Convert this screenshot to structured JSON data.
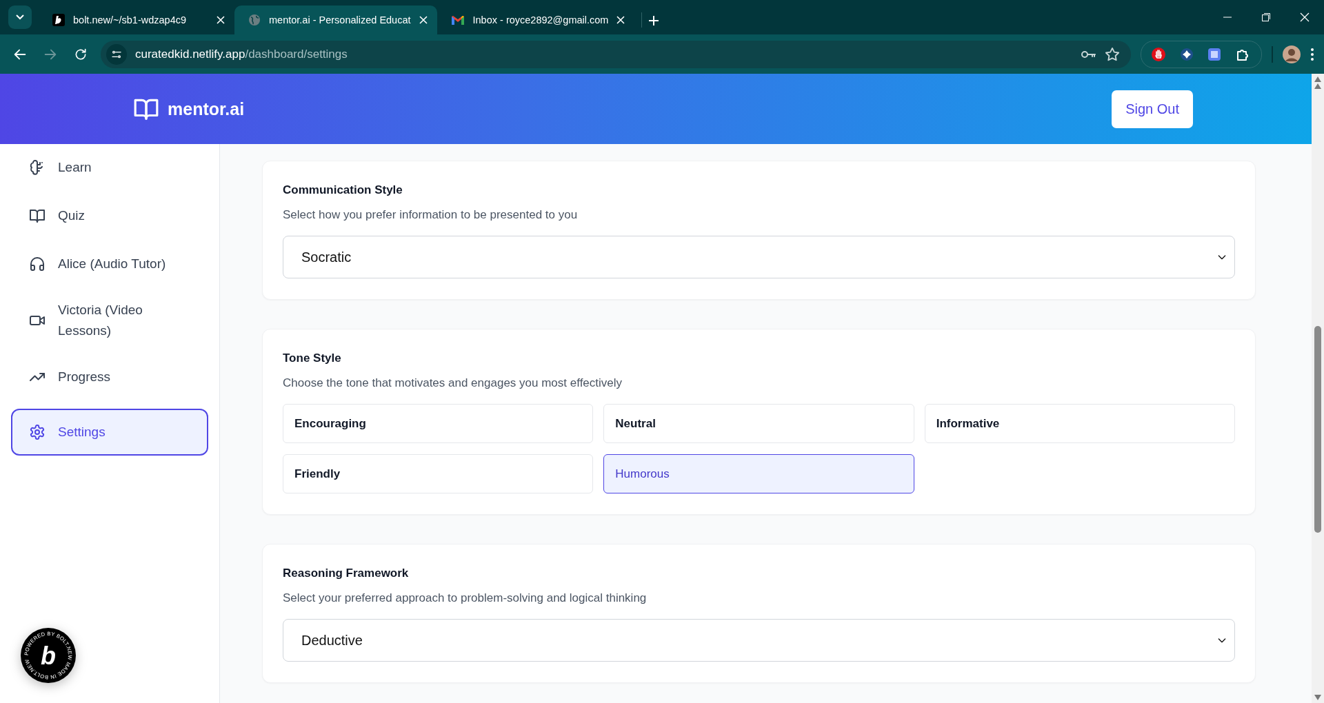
{
  "browser": {
    "tabs": [
      {
        "title": "bolt.new/~/sb1-wdzap4c9",
        "selected": false
      },
      {
        "title": "mentor.ai - Personalized Educat",
        "selected": true
      },
      {
        "title": "Inbox - royce2892@gmail.com",
        "selected": false
      }
    ],
    "url_host": "curatedkid.netlify.app",
    "url_path": "/dashboard/settings"
  },
  "header": {
    "brand": "mentor.ai",
    "sign_out": "Sign Out"
  },
  "sidebar": {
    "items": [
      {
        "label": "Learn",
        "selected": false
      },
      {
        "label": "Quiz",
        "selected": false
      },
      {
        "label": "Alice (Audio Tutor)",
        "selected": false
      },
      {
        "label": "Victoria (Video Lessons)",
        "selected": false
      },
      {
        "label": "Progress",
        "selected": false
      },
      {
        "label": "Settings",
        "selected": true
      }
    ]
  },
  "sections": [
    {
      "kind": "select",
      "title": "Communication Style",
      "description": "Select how you prefer information to be presented to you",
      "value": "Socratic"
    },
    {
      "kind": "options",
      "title": "Tone Style",
      "description": "Choose the tone that motivates and engages you most effectively",
      "options": [
        {
          "label": "Encouraging",
          "selected": false
        },
        {
          "label": "Neutral",
          "selected": false
        },
        {
          "label": "Informative",
          "selected": false
        },
        {
          "label": "Friendly",
          "selected": false
        },
        {
          "label": "Humorous",
          "selected": true
        }
      ]
    },
    {
      "kind": "select",
      "title": "Reasoning Framework",
      "description": "Select your preferred approach to problem-solving and logical thinking",
      "value": "Deductive"
    }
  ],
  "badge": {
    "ring_text": "POWERED BY BOLT.NEW MADE IN BOLT.NEW ",
    "letter": "b"
  }
}
